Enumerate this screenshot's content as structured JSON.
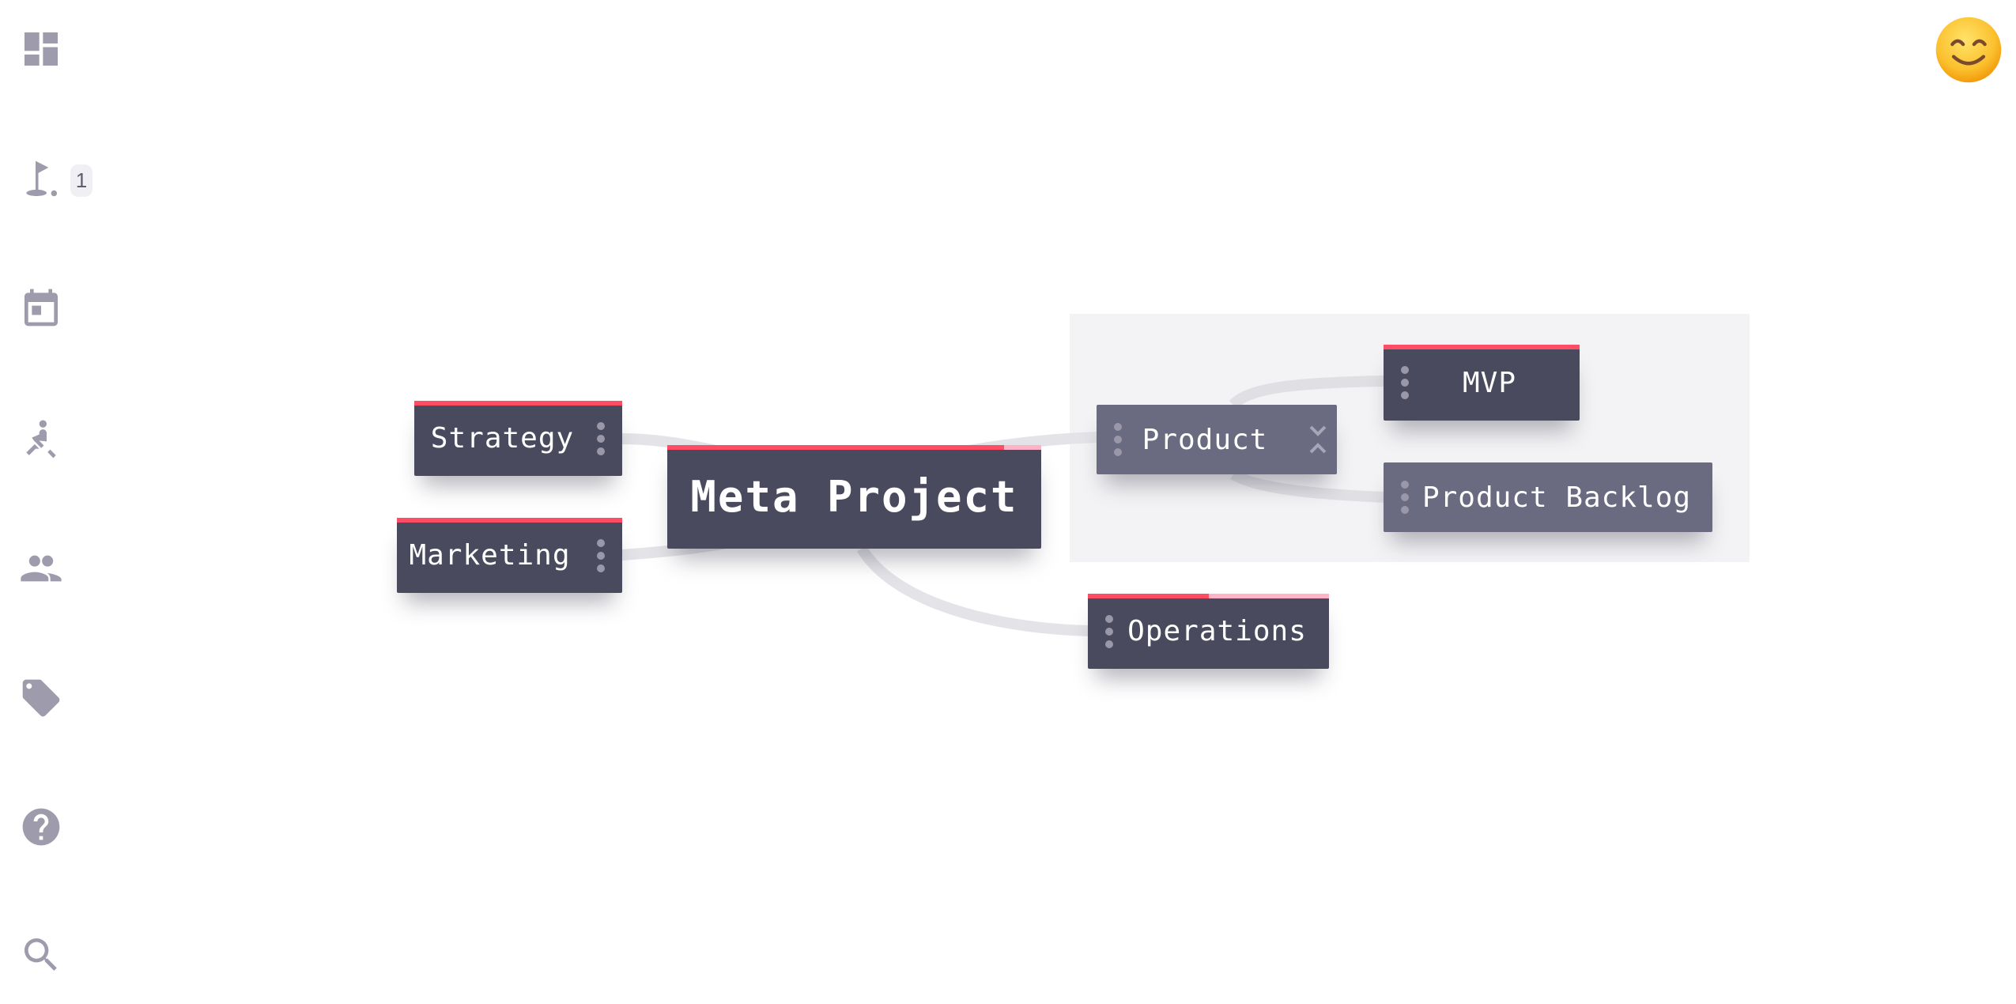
{
  "sidebar": {
    "items": [
      {
        "name": "dashboard",
        "icon": "dashboard-icon"
      },
      {
        "name": "goals",
        "icon": "golf-flag-icon",
        "badge": "1"
      },
      {
        "name": "calendar",
        "icon": "calendar-icon"
      },
      {
        "name": "activities",
        "icon": "rowing-icon"
      },
      {
        "name": "team",
        "icon": "people-icon"
      },
      {
        "name": "tags",
        "icon": "tag-icon"
      },
      {
        "name": "help",
        "icon": "help-icon"
      },
      {
        "name": "search",
        "icon": "search-icon"
      }
    ]
  },
  "user": {
    "avatar": "😊"
  },
  "colors": {
    "node_dark": "#4a4a5e",
    "node_light": "#6a6a80",
    "progress_fill": "#ff4d66",
    "progress_track": "#ffb3c8",
    "sidebar_icon": "#9e9cac",
    "link": "#e2e2e6",
    "group_bg": "#f3f3f5"
  },
  "mindmap": {
    "root": {
      "label": "Meta Project",
      "progress": 0.9
    },
    "nodes": [
      {
        "id": "strategy",
        "label": "Strategy",
        "progress": 1.0
      },
      {
        "id": "marketing",
        "label": "Marketing",
        "progress": 1.0
      },
      {
        "id": "product",
        "label": "Product",
        "progress": null,
        "expanded": true
      },
      {
        "id": "mvp",
        "label": "MVP",
        "progress": 1.0,
        "parent": "product"
      },
      {
        "id": "backlog",
        "label": "Product Backlog",
        "progress": null,
        "parent": "product"
      },
      {
        "id": "operations",
        "label": "Operations",
        "progress": 0.5
      }
    ]
  }
}
